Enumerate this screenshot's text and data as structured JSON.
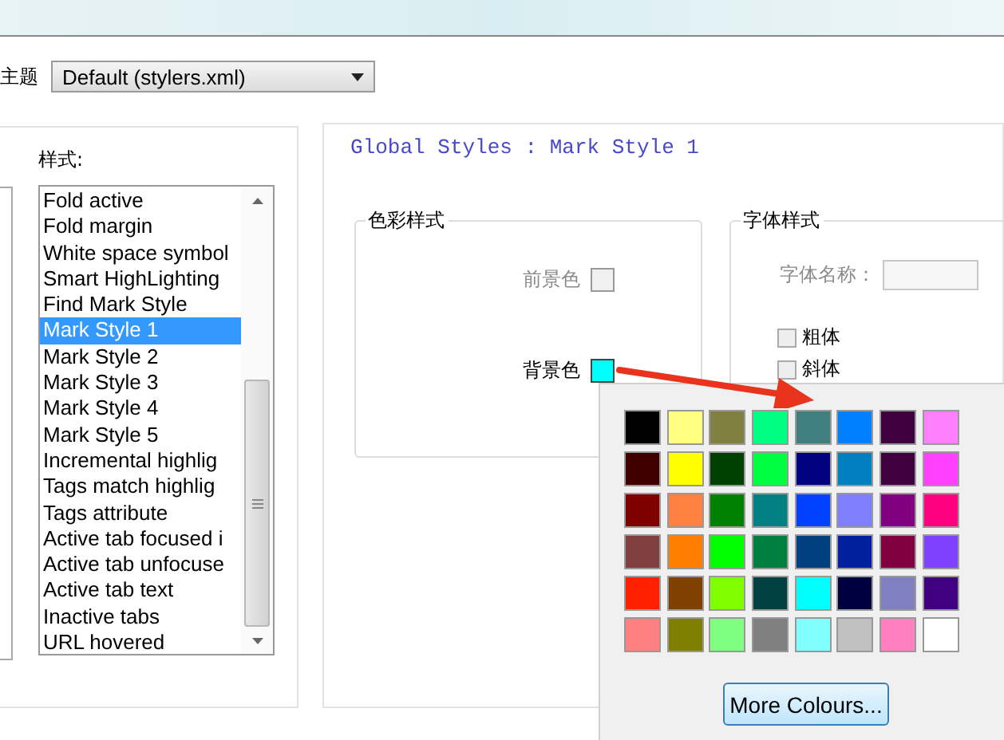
{
  "theme": {
    "label": "主题",
    "value": "Default (stylers.xml)"
  },
  "styles": {
    "label": "样式:",
    "items": [
      {
        "label": "Fold active",
        "selected": false
      },
      {
        "label": "Fold margin",
        "selected": false
      },
      {
        "label": "White space symbol",
        "selected": false
      },
      {
        "label": "Smart HighLighting",
        "selected": false
      },
      {
        "label": "Find Mark Style",
        "selected": false
      },
      {
        "label": "Mark Style 1",
        "selected": true
      },
      {
        "label": "Mark Style 2",
        "selected": false
      },
      {
        "label": "Mark Style 3",
        "selected": false
      },
      {
        "label": "Mark Style 4",
        "selected": false
      },
      {
        "label": "Mark Style 5",
        "selected": false
      },
      {
        "label": "Incremental highlig",
        "selected": false
      },
      {
        "label": "Tags match highlig",
        "selected": false
      },
      {
        "label": "Tags attribute",
        "selected": false
      },
      {
        "label": "Active tab focused i",
        "selected": false
      },
      {
        "label": "Active tab unfocuse",
        "selected": false
      },
      {
        "label": "Active tab text",
        "selected": false
      },
      {
        "label": "Inactive tabs",
        "selected": false
      },
      {
        "label": "URL hovered",
        "selected": false
      }
    ]
  },
  "detail": {
    "title": "Global Styles : Mark Style 1",
    "color_style": {
      "label": "色彩样式",
      "rows": [
        {
          "label": "前景色",
          "color": "#f0f0f0",
          "disabled": true
        },
        {
          "label": "背景色",
          "color": "#00ffff",
          "disabled": false
        }
      ]
    },
    "font_style": {
      "label": "字体样式",
      "font_name": {
        "label": "字体名称：",
        "disabled": true
      },
      "options": [
        {
          "label": "粗体",
          "checked": false
        },
        {
          "label": "斜体",
          "checked": false
        }
      ]
    }
  },
  "color_picker": {
    "swatches": [
      {
        "color": "#000000"
      },
      {
        "color": "#ffff80"
      },
      {
        "color": "#808040"
      },
      {
        "color": "#00ff80"
      },
      {
        "color": "#408080"
      },
      {
        "color": "#0080ff"
      },
      {
        "color": "#400040"
      },
      {
        "color": "#ff80ff"
      },
      {
        "color": "#400000"
      },
      {
        "color": "#ffff00"
      },
      {
        "color": "#004000"
      },
      {
        "color": "#00ff40"
      },
      {
        "color": "#000080"
      },
      {
        "color": "#0080c0"
      },
      {
        "color": "#400040"
      },
      {
        "color": "#ff40ff"
      },
      {
        "color": "#800000"
      },
      {
        "color": "#ff8040"
      },
      {
        "color": "#008000"
      },
      {
        "color": "#008080"
      },
      {
        "color": "#0040ff"
      },
      {
        "color": "#8080ff"
      },
      {
        "color": "#800080"
      },
      {
        "color": "#ff0080"
      },
      {
        "color": "#804040"
      },
      {
        "color": "#ff8000"
      },
      {
        "color": "#00ff00"
      },
      {
        "color": "#008040"
      },
      {
        "color": "#004080"
      },
      {
        "color": "#0020a0"
      },
      {
        "color": "#800040"
      },
      {
        "color": "#8040ff"
      },
      {
        "color": "#ff2000"
      },
      {
        "color": "#804000"
      },
      {
        "color": "#80ff00"
      },
      {
        "color": "#004040"
      },
      {
        "color": "#00ffff"
      },
      {
        "color": "#000040"
      },
      {
        "color": "#8080c0"
      },
      {
        "color": "#400080"
      },
      {
        "color": "#ff8080"
      },
      {
        "color": "#808000"
      },
      {
        "color": "#80ff80"
      },
      {
        "color": "#808080"
      },
      {
        "color": "#80ffff"
      },
      {
        "color": "#c0c0c0"
      },
      {
        "color": "#ff80c0"
      },
      {
        "color": "#ffffff"
      }
    ],
    "more_button": "More Colours..."
  }
}
